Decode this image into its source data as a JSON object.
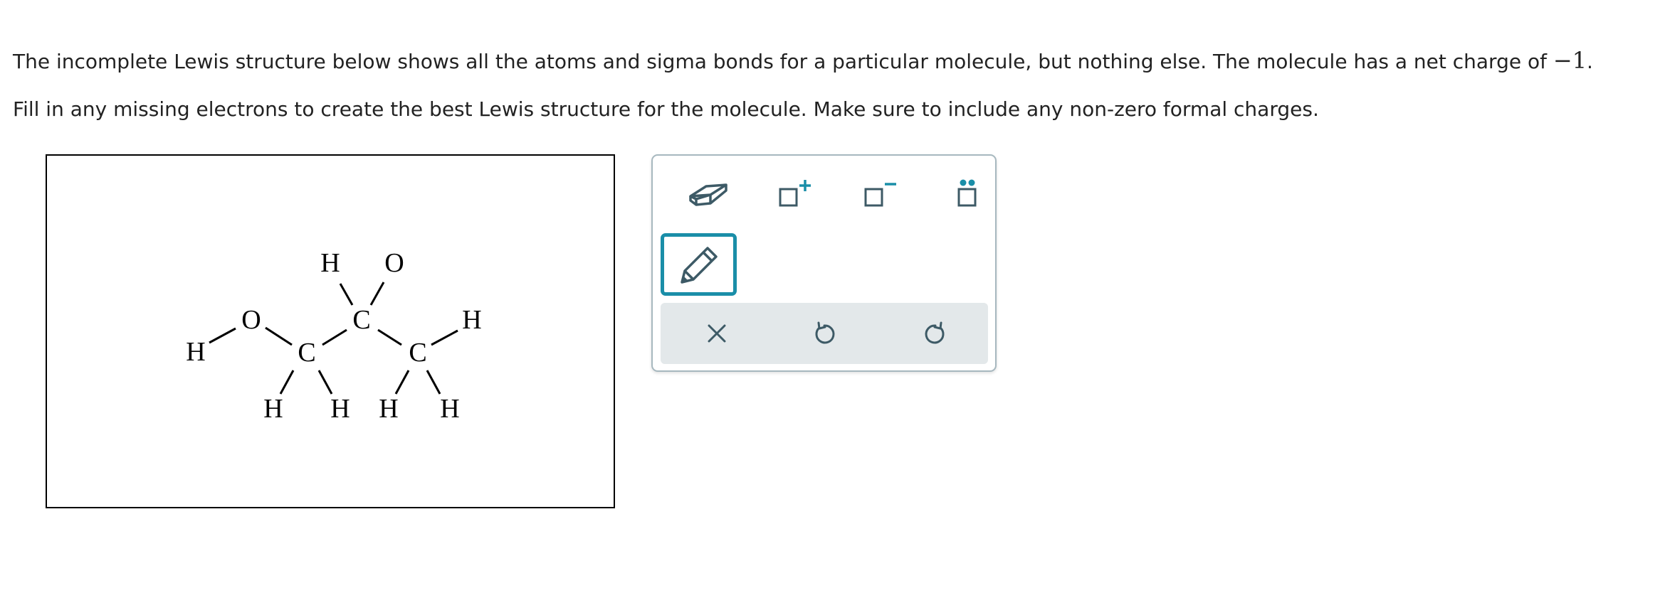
{
  "question": {
    "line1": "The incomplete Lewis structure below shows all the atoms and sigma bonds for a particular molecule, but nothing else. The molecule has a net charge of",
    "charge": "−1",
    "line1_end": ".",
    "line2": "Fill in any missing electrons to create the best Lewis structure for the molecule. Make sure to include any non-zero formal charges."
  },
  "molecule": {
    "atoms": {
      "h_left": "H",
      "o_left": "O",
      "c_left": "C",
      "h_c_left_1": "H",
      "h_c_left_2": "H",
      "c_mid": "C",
      "h_c_mid": "H",
      "o_top": "O",
      "c_right": "C",
      "h_c_right_top": "H",
      "h_c_right_1": "H",
      "h_c_right_2": "H"
    }
  },
  "toolbar": {
    "tools": {
      "eraser": "eraser-icon",
      "positive_charge": "positive-charge-icon",
      "negative_charge": "negative-charge-icon",
      "lone_pair": "lone-pair-icon",
      "pencil": "pencil-icon"
    },
    "selected_tool": "pencil",
    "actions": {
      "clear": "close-icon",
      "undo": "undo-icon",
      "redo": "redo-icon"
    }
  },
  "colors": {
    "accent": "#1a8ea8",
    "icon": "#3d5a66",
    "action_bar": "#e3e8ea",
    "palette_border": "#a7b8bf"
  }
}
